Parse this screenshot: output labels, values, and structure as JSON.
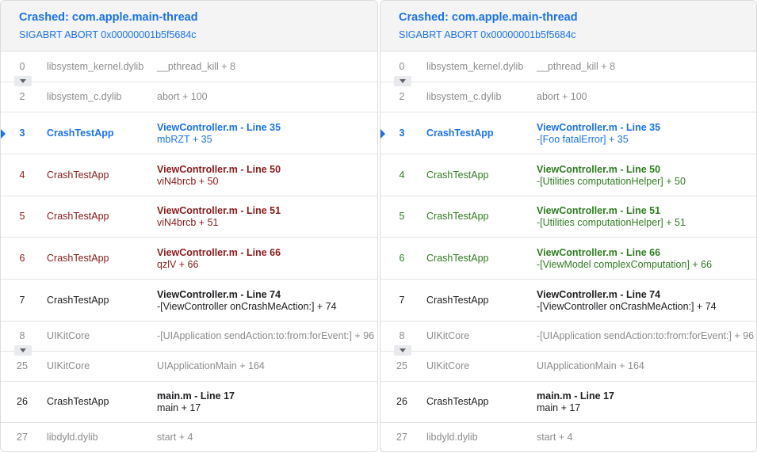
{
  "panels": [
    {
      "title": "Crashed: com.apple.main-thread",
      "subtitle": "SIGABRT ABORT 0x00000001b5f5684c",
      "frames": [
        {
          "num": "0",
          "lib": "libsystem_kernel.dylib",
          "sym": "__pthread_kill + 8",
          "style": "gray"
        },
        {
          "num": "2",
          "lib": "libsystem_c.dylib",
          "sym": "abort + 100",
          "style": "gray"
        },
        {
          "num": "3",
          "lib": "CrashTestApp",
          "file": "ViewController.m - Line 35",
          "sym": "mbRZT + 35",
          "style": "blue"
        },
        {
          "num": "4",
          "lib": "CrashTestApp",
          "file": "ViewController.m - Line 50",
          "sym": "viN4brcb + 50",
          "style": "red"
        },
        {
          "num": "5",
          "lib": "CrashTestApp",
          "file": "ViewController.m - Line 51",
          "sym": "viN4brcb + 51",
          "style": "red"
        },
        {
          "num": "6",
          "lib": "CrashTestApp",
          "file": "ViewController.m - Line 66",
          "sym": "qzlV + 66",
          "style": "red"
        },
        {
          "num": "7",
          "lib": "CrashTestApp",
          "file": "ViewController.m - Line 74",
          "sym": "-[ViewController onCrashMeAction:] + 74",
          "style": "black"
        },
        {
          "num": "8",
          "lib": "UIKitCore",
          "sym": "-[UIApplication sendAction:to:from:forEvent:] + 96",
          "style": "gray"
        },
        {
          "num": "25",
          "lib": "UIKitCore",
          "sym": "UIApplicationMain + 164",
          "style": "gray"
        },
        {
          "num": "26",
          "lib": "CrashTestApp",
          "file": "main.m - Line 17",
          "sym": "main + 17",
          "style": "black"
        },
        {
          "num": "27",
          "lib": "libdyld.dylib",
          "sym": "start + 4",
          "style": "gray"
        }
      ]
    },
    {
      "title": "Crashed: com.apple.main-thread",
      "subtitle": "SIGABRT ABORT 0x00000001b5f5684c",
      "frames": [
        {
          "num": "0",
          "lib": "libsystem_kernel.dylib",
          "sym": "__pthread_kill + 8",
          "style": "gray"
        },
        {
          "num": "2",
          "lib": "libsystem_c.dylib",
          "sym": "abort + 100",
          "style": "gray"
        },
        {
          "num": "3",
          "lib": "CrashTestApp",
          "file": "ViewController.m - Line 35",
          "sym": "-[Foo fatalError] + 35",
          "style": "blue"
        },
        {
          "num": "4",
          "lib": "CrashTestApp",
          "file": "ViewController.m - Line 50",
          "sym": "-[Utilities computationHelper] + 50",
          "style": "green"
        },
        {
          "num": "5",
          "lib": "CrashTestApp",
          "file": "ViewController.m - Line 51",
          "sym": "-[Utilities computationHelper] + 51",
          "style": "green"
        },
        {
          "num": "6",
          "lib": "CrashTestApp",
          "file": "ViewController.m - Line 66",
          "sym": "-[ViewModel complexComputation] + 66",
          "style": "green"
        },
        {
          "num": "7",
          "lib": "CrashTestApp",
          "file": "ViewController.m - Line 74",
          "sym": "-[ViewController onCrashMeAction:] + 74",
          "style": "black"
        },
        {
          "num": "8",
          "lib": "UIKitCore",
          "sym": "-[UIApplication sendAction:to:from:forEvent:] + 96",
          "style": "gray"
        },
        {
          "num": "25",
          "lib": "UIKitCore",
          "sym": "UIApplicationMain + 164",
          "style": "gray"
        },
        {
          "num": "26",
          "lib": "CrashTestApp",
          "file": "main.m - Line 17",
          "sym": "main + 17",
          "style": "black"
        },
        {
          "num": "27",
          "lib": "libdyld.dylib",
          "sym": "start + 4",
          "style": "gray"
        }
      ]
    }
  ],
  "colors": {
    "blue": "#1a73e8",
    "red": "#8b1a1a",
    "green": "#2e7d20",
    "gray": "#8c8c8c",
    "black": "#202124"
  },
  "icons": {
    "collapse": "chevron-down-icon",
    "active_frame": "triangle-right-icon"
  }
}
